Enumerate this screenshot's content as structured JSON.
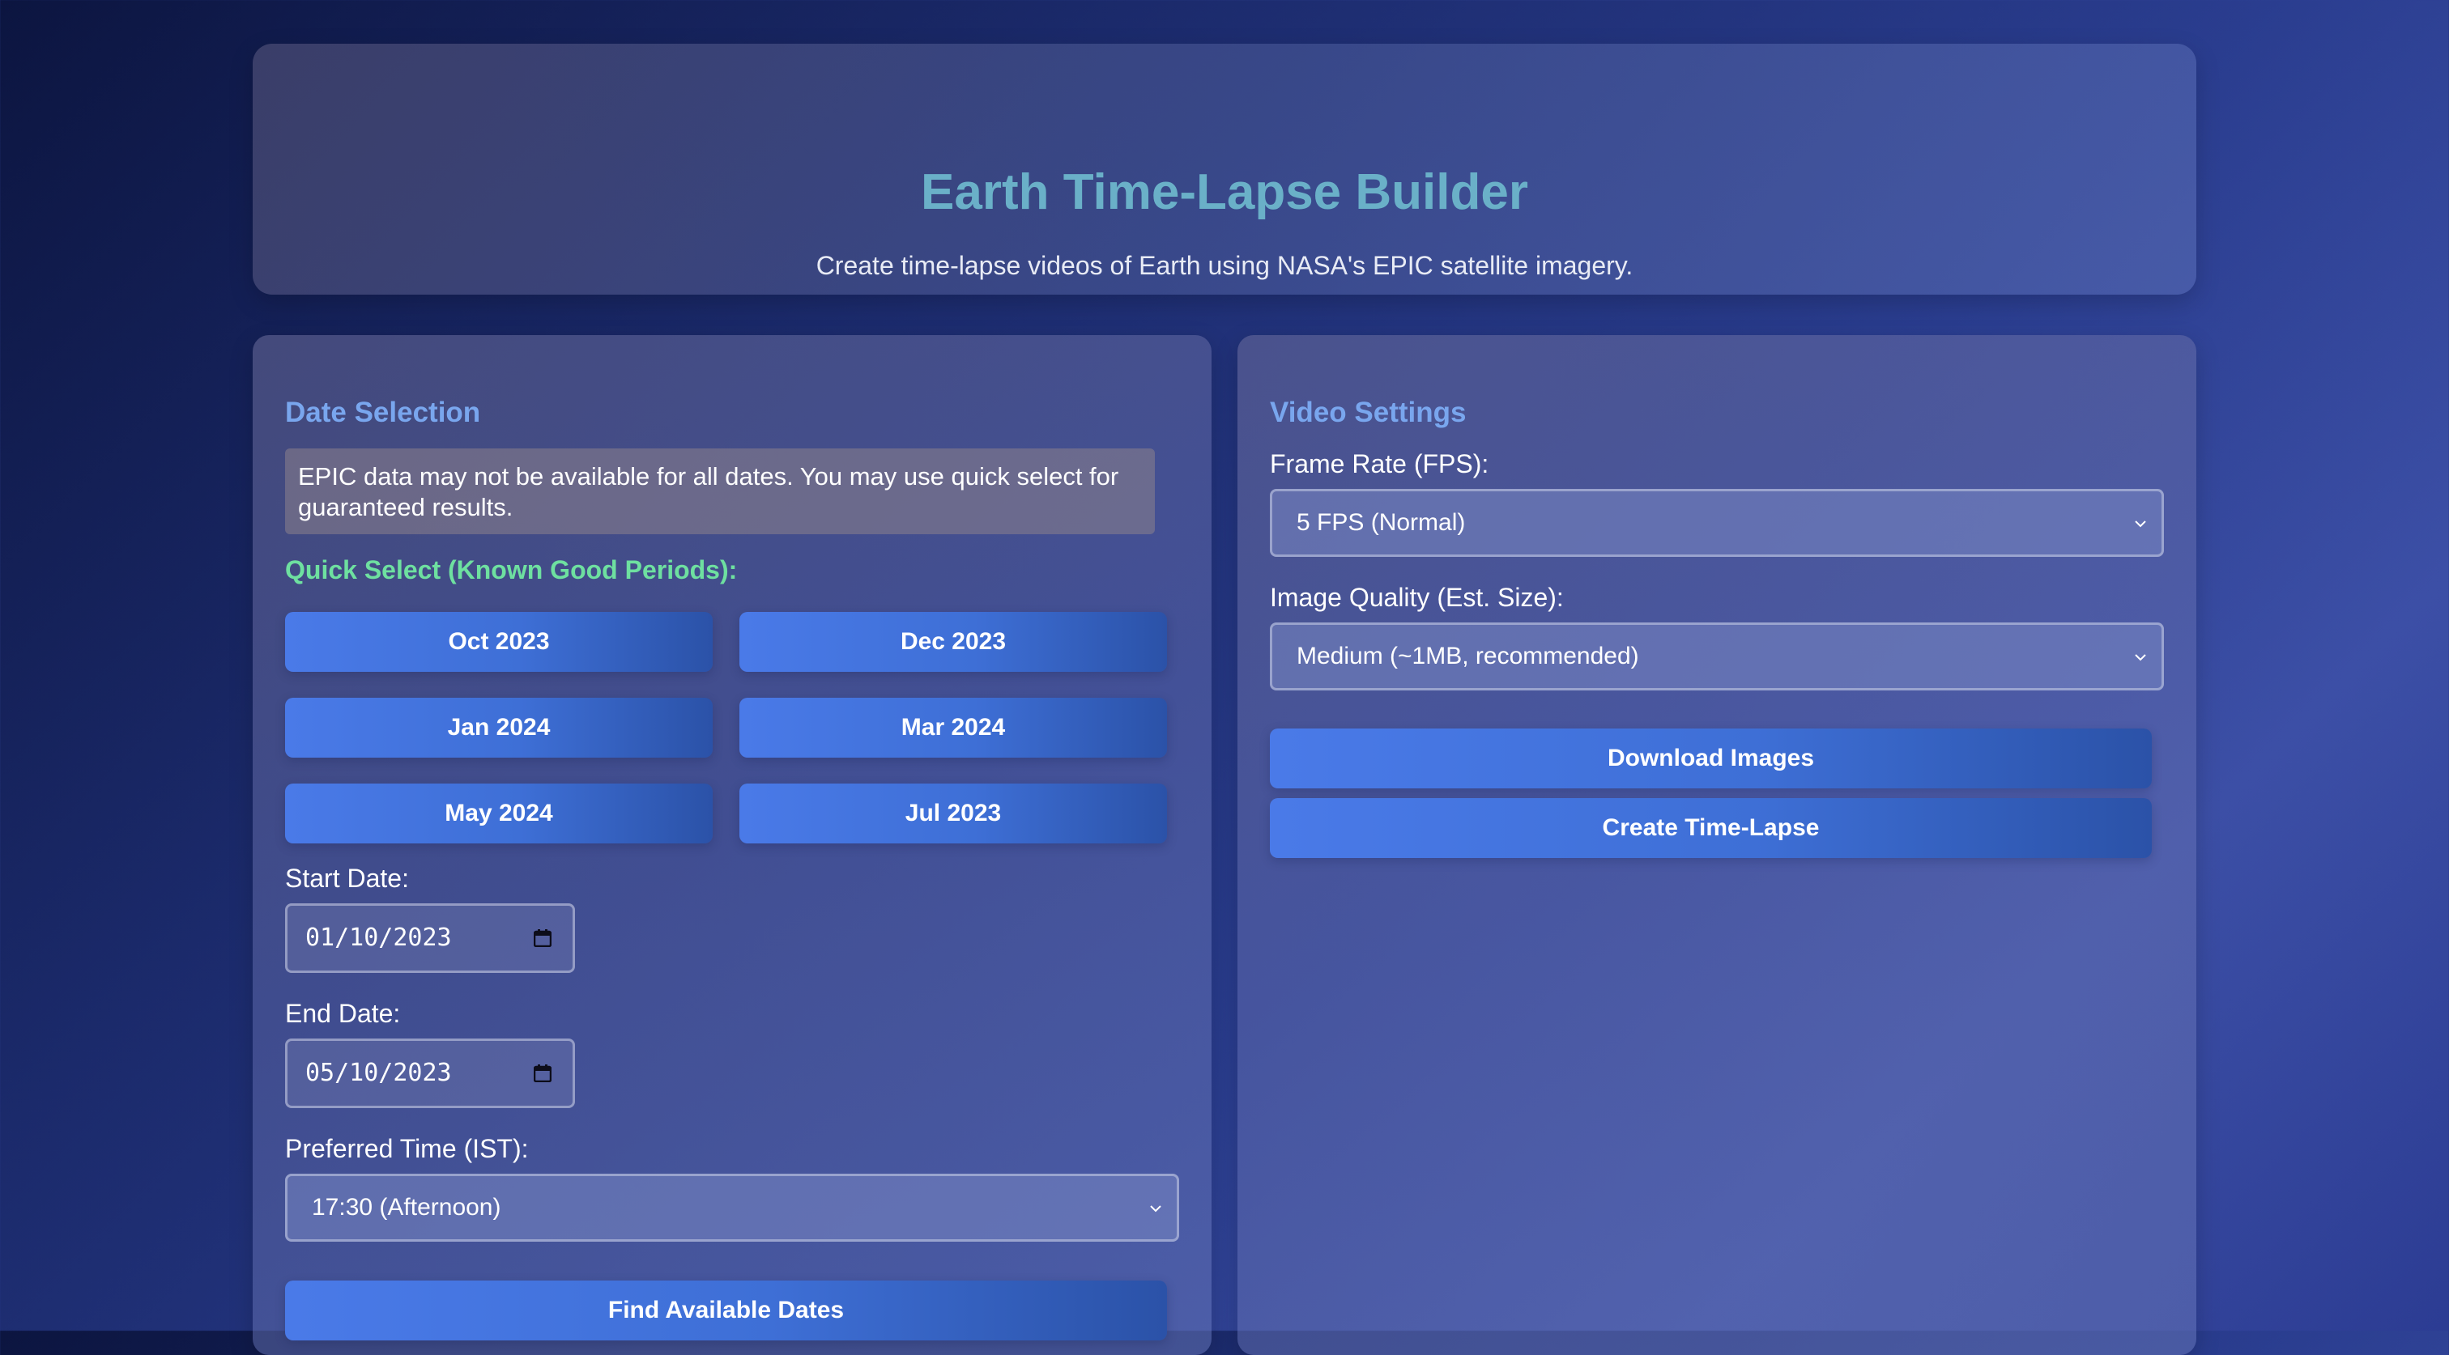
{
  "header": {
    "title": "Earth Time-Lapse Builder",
    "subtitle": "Create time-lapse videos of Earth using NASA's EPIC satellite imagery."
  },
  "date_selection": {
    "title": "Date Selection",
    "notice": "EPIC data may not be available for all dates. You may use quick select for guaranteed results.",
    "quick_select_title": "Quick Select (Known Good Periods):",
    "quick_buttons": [
      "Oct 2023",
      "Dec 2023",
      "Jan 2024",
      "Mar 2024",
      "May 2024",
      "Jul 2023"
    ],
    "start_label": "Start Date:",
    "start_value": "01/10/2023",
    "end_label": "End Date:",
    "end_value": "05/10/2023",
    "time_label": "Preferred Time (IST):",
    "time_value": "17:30 (Afternoon)",
    "find_button": "Find Available Dates"
  },
  "video_settings": {
    "title": "Video Settings",
    "fps_label": "Frame Rate (FPS):",
    "fps_value": "5 FPS (Normal)",
    "quality_label": "Image Quality (Est. Size):",
    "quality_value": "Medium (~1MB, recommended)",
    "download_button": "Download Images",
    "create_button": "Create Time-Lapse"
  },
  "colors": {
    "accent_title": "#6ab0c8",
    "section_title": "#79a6ee",
    "quick_select": "#6ee0a0",
    "button": "#3e6fd6"
  }
}
